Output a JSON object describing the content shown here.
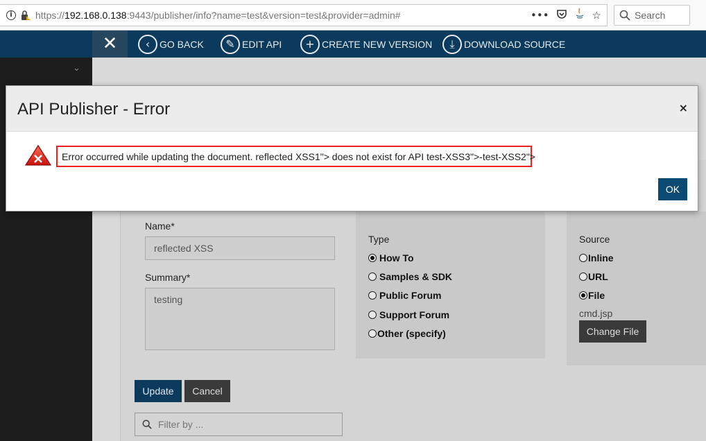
{
  "browser": {
    "url_scheme": "https://",
    "url_host": "192.168.0.138",
    "url_path": ":9443/publisher/info?name=test&version=test&provider=admin#",
    "search_label": "Search"
  },
  "appbar": {
    "close_glyph": "✕",
    "nav": [
      {
        "label": "GO BACK",
        "icon": "chevron-left-circle-icon"
      },
      {
        "label": "EDIT API",
        "icon": "pencil-circle-icon"
      },
      {
        "label": "CREATE NEW VERSION",
        "icon": "plus-circle-icon"
      },
      {
        "label": "DOWNLOAD SOURCE",
        "icon": "download-circle-icon"
      }
    ]
  },
  "form": {
    "name_label": "Name*",
    "name_value": "reflected XSS",
    "summary_label": "Summary*",
    "summary_value": "testing",
    "type_label": "Type",
    "type_options": [
      {
        "label": "How To",
        "checked": true
      },
      {
        "label": "Samples & SDK",
        "checked": false
      },
      {
        "label": "Public Forum",
        "checked": false
      },
      {
        "label": "Support Forum",
        "checked": false
      },
      {
        "label": "Other (specify)",
        "checked": false
      }
    ],
    "source_label": "Source",
    "source_options": [
      {
        "label": "Inline",
        "checked": false
      },
      {
        "label": "URL",
        "checked": false
      },
      {
        "label": "File",
        "checked": true
      }
    ],
    "file_name": "cmd.jsp",
    "change_file_label": "Change File",
    "update_label": "Update",
    "cancel_label": "Cancel",
    "filter_placeholder": "Filter by ..."
  },
  "modal": {
    "title": "API Publisher - Error",
    "close_glyph": "×",
    "message": "Error occurred while updating the document. reflected XSS1\"> does not exist for API test-XSS3\">-test-XSS2\">",
    "ok_label": "OK"
  },
  "colors": {
    "header": "#0b3a5c",
    "highlight_border": "#e22222",
    "ok_button": "#0b4a72"
  }
}
